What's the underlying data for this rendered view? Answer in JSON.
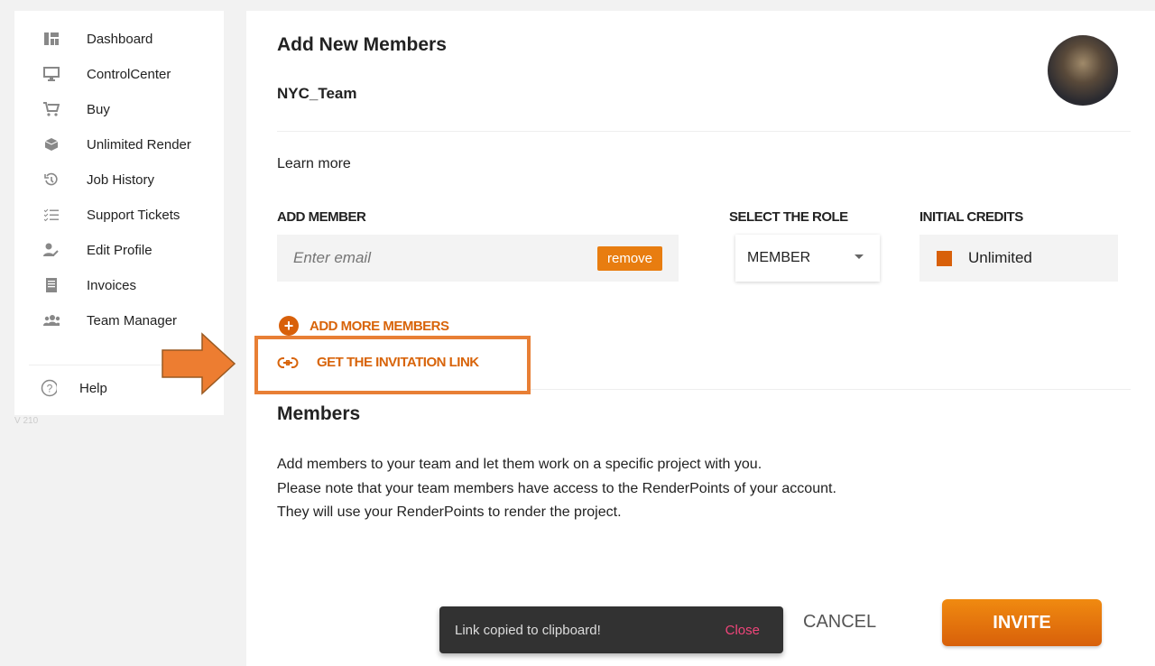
{
  "sidebar": {
    "items": [
      {
        "label": "Dashboard",
        "icon": "dashboard-icon"
      },
      {
        "label": "ControlCenter",
        "icon": "monitor-icon"
      },
      {
        "label": "Buy",
        "icon": "cart-icon"
      },
      {
        "label": "Unlimited Render",
        "icon": "cube-icon"
      },
      {
        "label": "Job History",
        "icon": "history-icon"
      },
      {
        "label": "Support Tickets",
        "icon": "checklist-icon"
      },
      {
        "label": "Edit Profile",
        "icon": "user-edit-icon"
      },
      {
        "label": "Invoices",
        "icon": "invoice-icon"
      },
      {
        "label": "Team Manager",
        "icon": "team-icon"
      }
    ],
    "help": "Help",
    "version": "V 210"
  },
  "main": {
    "title": "Add New Members",
    "team": "NYC_Team",
    "learn_more": "Learn more",
    "add_member_label": "ADD MEMBER",
    "email_placeholder": "Enter email",
    "remove": "remove",
    "role_label": "SELECT THE ROLE",
    "role_value": "MEMBER",
    "credits_label": "INITIAL CREDITS",
    "credits_value": "Unlimited",
    "add_more": "ADD MORE MEMBERS",
    "invite_link": "GET THE INVITATION LINK",
    "members_title": "Members",
    "desc": [
      "Add members to your team and let them work on a specific project with you.",
      "Please note that your team members have access to the RenderPoints of your account.",
      "They will use your RenderPoints to render the project."
    ],
    "cancel": "CANCEL",
    "invite": "INVITE"
  },
  "toast": {
    "message": "Link copied to clipboard!",
    "close": "Close"
  },
  "colors": {
    "accent": "#e87d10",
    "highlight": "#e87f35",
    "toast_close": "#f0457a"
  }
}
